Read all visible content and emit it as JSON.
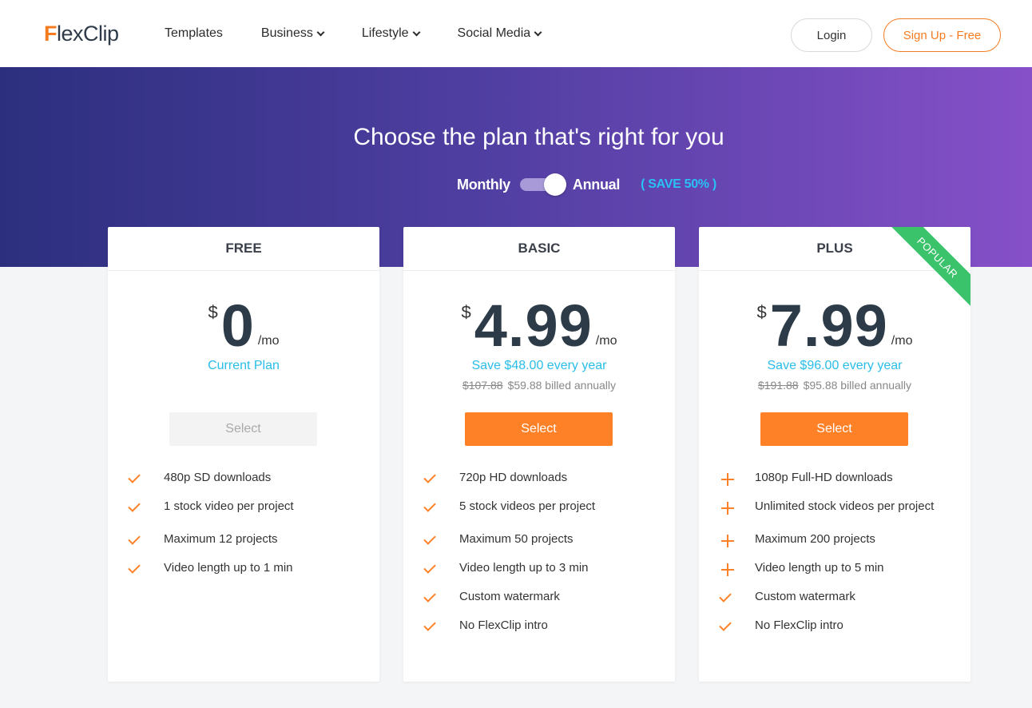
{
  "header": {
    "logo_text_f": "F",
    "logo_text_rest": "lexClip",
    "nav": [
      {
        "label": "Templates",
        "dropdown": false
      },
      {
        "label": "Business",
        "dropdown": true
      },
      {
        "label": "Lifestyle",
        "dropdown": true
      },
      {
        "label": "Social Media",
        "dropdown": true
      }
    ],
    "login_label": "Login",
    "signup_label": "Sign Up - Free"
  },
  "hero": {
    "title": "Choose the plan that's right for you",
    "monthly_label": "Monthly",
    "annual_label": "Annual",
    "save_label": "( SAVE 50% )",
    "billing_selected": "Annual"
  },
  "plans": [
    {
      "name": "FREE",
      "currency": "$",
      "amount": "0",
      "per": "/mo",
      "subtitle": "Current Plan",
      "old_price": "",
      "billed": "",
      "select_label": "Select",
      "select_disabled": true,
      "features": [
        {
          "icon": "check-icon",
          "text": "480p SD downloads"
        },
        {
          "icon": "check-icon",
          "text": "1 stock video per project"
        },
        {
          "icon": "check-icon",
          "text": "Maximum 12 projects"
        },
        {
          "icon": "check-icon",
          "text": "Video length up to 1 min"
        }
      ]
    },
    {
      "name": "BASIC",
      "currency": "$",
      "amount": "4.99",
      "per": "/mo",
      "subtitle": "Save $48.00 every year",
      "old_price": "$107.88",
      "billed": "$59.88 billed annually",
      "select_label": "Select",
      "select_disabled": false,
      "features": [
        {
          "icon": "check-icon",
          "text": "720p HD downloads"
        },
        {
          "icon": "check-icon",
          "text": "5 stock videos per project"
        },
        {
          "icon": "check-icon",
          "text": "Maximum 50 projects"
        },
        {
          "icon": "check-icon",
          "text": "Video length up to 3 min"
        },
        {
          "icon": "check-icon",
          "text": "Custom watermark"
        },
        {
          "icon": "check-icon",
          "text": "No FlexClip intro"
        }
      ]
    },
    {
      "name": "PLUS",
      "currency": "$",
      "amount": "7.99",
      "per": "/mo",
      "subtitle": "Save $96.00 every year",
      "old_price": "$191.88",
      "billed": "$95.88 billed annually",
      "select_label": "Select",
      "select_disabled": false,
      "ribbon": "POPULAR",
      "features": [
        {
          "icon": "plus-icon",
          "text": "1080p Full-HD downloads"
        },
        {
          "icon": "plus-icon",
          "text": "Unlimited stock videos per project"
        },
        {
          "icon": "plus-icon",
          "text": "Maximum 200 projects"
        },
        {
          "icon": "plus-icon",
          "text": "Video length up to 5 min"
        },
        {
          "icon": "check-icon",
          "text": "Custom watermark"
        },
        {
          "icon": "check-icon",
          "text": "No FlexClip intro"
        }
      ]
    }
  ],
  "colors": {
    "accent_orange": "#ff8127",
    "save_blue": "#29bde8",
    "ribbon_green": "#3bc36c",
    "hero_gradient_start": "#2c2f7e",
    "hero_gradient_end": "#8650c8"
  }
}
